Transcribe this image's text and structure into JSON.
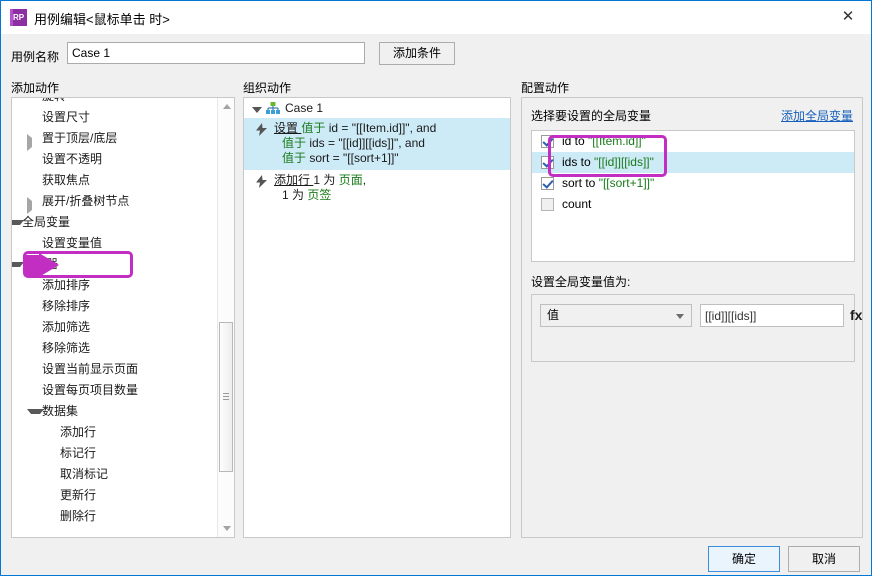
{
  "window": {
    "title": "用例编辑<鼠标单击 时>",
    "app_icon": "RP",
    "close_icon": "✕",
    "accent_color": "#0078d7",
    "highlight_color": "#c22ec2"
  },
  "casebar": {
    "label": "用例名称",
    "value": "Case 1",
    "placeholder": "",
    "add_condition_label": "添加条件"
  },
  "sections": {
    "add_action": "添加动作",
    "organize_action": "组织动作",
    "configure_action": "配置动作"
  },
  "tree": {
    "items": [
      {
        "label": "旋转",
        "indent": 2,
        "arrow": "none"
      },
      {
        "label": "设置尺寸",
        "indent": 2,
        "arrow": "none"
      },
      {
        "label": "置于顶层/底层",
        "indent": 2,
        "arrow": "collapsed"
      },
      {
        "label": "设置不透明",
        "indent": 2,
        "arrow": "none"
      },
      {
        "label": "获取焦点",
        "indent": 2,
        "arrow": "none"
      },
      {
        "label": "展开/折叠树节点",
        "indent": 2,
        "arrow": "collapsed"
      },
      {
        "label": "全局变量",
        "indent": 1,
        "arrow": "expanded"
      },
      {
        "label": "设置变量值",
        "indent": 2,
        "arrow": "none",
        "highlighted": true
      },
      {
        "label": "中继器",
        "indent": 1,
        "arrow": "expanded"
      },
      {
        "label": "添加排序",
        "indent": 2,
        "arrow": "none"
      },
      {
        "label": "移除排序",
        "indent": 2,
        "arrow": "none"
      },
      {
        "label": "添加筛选",
        "indent": 2,
        "arrow": "none"
      },
      {
        "label": "移除筛选",
        "indent": 2,
        "arrow": "none"
      },
      {
        "label": "设置当前显示页面",
        "indent": 2,
        "arrow": "none"
      },
      {
        "label": "设置每页项目数量",
        "indent": 2,
        "arrow": "none"
      },
      {
        "label": "数据集",
        "indent": 2,
        "arrow": "expanded"
      },
      {
        "label": "添加行",
        "indent": 3,
        "arrow": "none"
      },
      {
        "label": "标记行",
        "indent": 3,
        "arrow": "none"
      },
      {
        "label": "取消标记",
        "indent": 3,
        "arrow": "none"
      },
      {
        "label": "更新行",
        "indent": 3,
        "arrow": "none"
      },
      {
        "label": "删除行",
        "indent": 3,
        "arrow": "none"
      }
    ],
    "scrollbar": {
      "up_icon": "▲",
      "down_icon": "▼"
    }
  },
  "organize": {
    "case_label": "Case 1",
    "case_icon": "sitemap-icon",
    "actions": [
      {
        "selected": true,
        "verb": "设置",
        "lines": [
          [
            {
              "t": "值于 ",
              "c": "green"
            },
            {
              "t": "id = \"[[Item.id]]\"",
              "c": "black"
            },
            {
              "t": ", and",
              "c": "black"
            }
          ],
          [
            {
              "t": "值于 ",
              "c": "green"
            },
            {
              "t": "ids = \"[[id]][[ids]]\"",
              "c": "black"
            },
            {
              "t": ", and",
              "c": "black"
            }
          ],
          [
            {
              "t": "值于 ",
              "c": "green"
            },
            {
              "t": "sort = \"[[sort+1]]\"",
              "c": "black"
            }
          ]
        ]
      },
      {
        "selected": false,
        "verb": "添加行",
        "lines": [
          [
            {
              "t": "1 为 ",
              "c": "black"
            },
            {
              "t": "页面",
              "c": "green"
            },
            {
              "t": ",",
              "c": "black"
            }
          ],
          [
            {
              "t": "1 为 ",
              "c": "black"
            },
            {
              "t": "页签",
              "c": "green"
            }
          ]
        ]
      }
    ]
  },
  "configure": {
    "list_title": "选择要设置的全局变量",
    "add_var_link": "添加全局变量",
    "variables": [
      {
        "name": "id",
        "connector": " to ",
        "value": "\"[[Item.id]]\"",
        "checked": true,
        "selected": false
      },
      {
        "name": "ids",
        "connector": " to ",
        "value": "\"[[id]][[ids]]\"",
        "checked": true,
        "selected": true
      },
      {
        "name": "sort",
        "connector": " to ",
        "value": "\"[[sort+1]]\"",
        "checked": true,
        "selected": false
      },
      {
        "name": "count",
        "connector": "",
        "value": "",
        "checked": false,
        "selected": false
      }
    ],
    "set_value_label": "设置全局变量值为:",
    "mode_select": {
      "selected": "值",
      "chevron": "chevron-down-icon"
    },
    "value_input": {
      "value": "[[id]][[ids]]",
      "placeholder": ""
    },
    "fx_label": "fx"
  },
  "footer": {
    "ok_label": "确定",
    "cancel_label": "取消"
  }
}
